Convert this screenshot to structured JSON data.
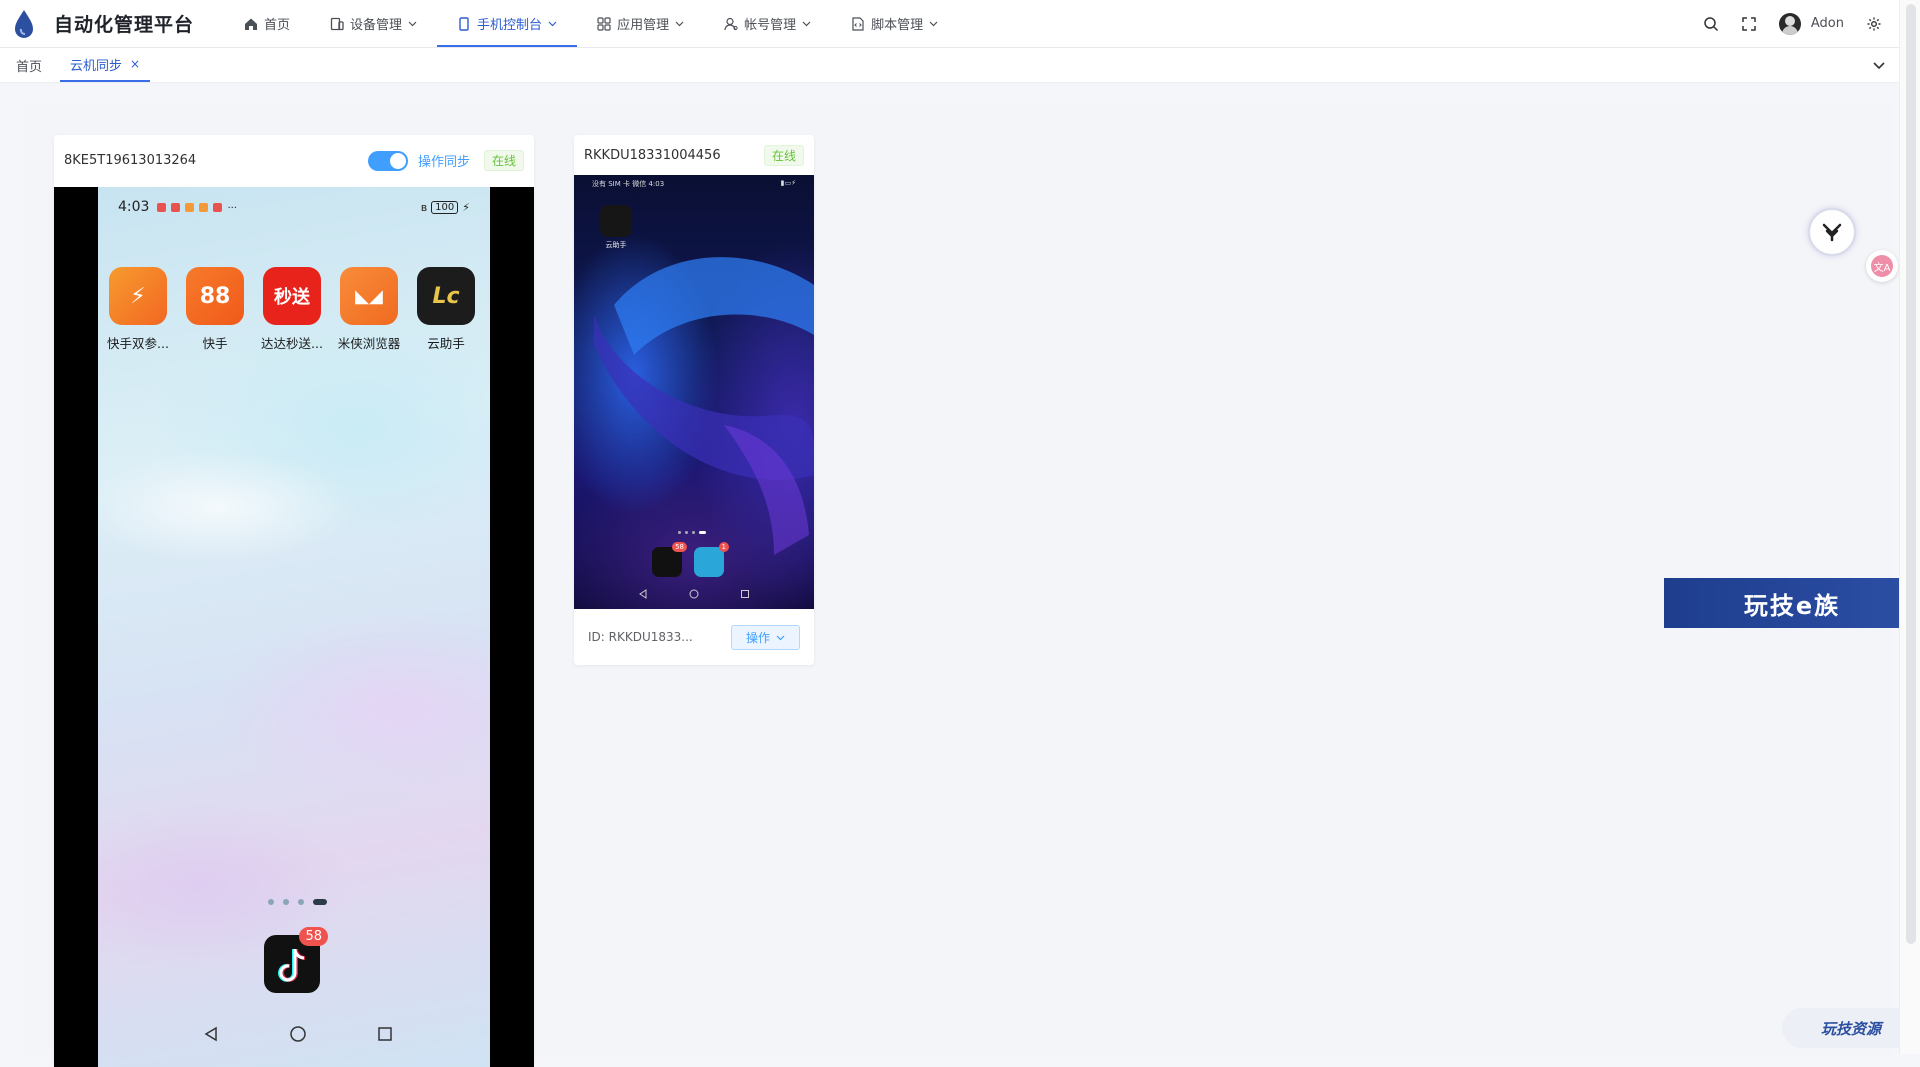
{
  "app": {
    "title": "自动化管理平台"
  },
  "nav": [
    {
      "label": "首页",
      "icon": "home-icon"
    },
    {
      "label": "设备管理",
      "icon": "device-icon"
    },
    {
      "label": "手机控制台",
      "icon": "phone-icon",
      "active": true
    },
    {
      "label": "应用管理",
      "icon": "apps-grid-icon"
    },
    {
      "label": "帐号管理",
      "icon": "user-icon"
    },
    {
      "label": "脚本管理",
      "icon": "code-file-icon"
    }
  ],
  "user": {
    "name": "Adon"
  },
  "tabs": [
    {
      "label": "首页"
    },
    {
      "label": "云机同步",
      "active": true,
      "close": "×"
    }
  ],
  "devices": {
    "d1": {
      "id": "8KE5T19613013264",
      "sync_label": "操作同步",
      "sync_on": true,
      "status": "在线",
      "screen": {
        "time": "4:03",
        "battery": "100",
        "apps": [
          {
            "label": "快手双参...",
            "color": "#f5811f",
            "glyph": "⚡"
          },
          {
            "label": "快手",
            "color": "#f56a1f",
            "glyph": "88"
          },
          {
            "label": "达达秒送...",
            "color": "#e8231c",
            "glyph": "秒送"
          },
          {
            "label": "米侠浏览器",
            "color": "#f4772a",
            "glyph": "◣◢"
          },
          {
            "label": "云助手",
            "color": "#1c1c1c",
            "glyph": "Lc"
          }
        ],
        "dock_badge": "58"
      }
    },
    "d2": {
      "id": "RKKDU18331004456",
      "status": "在线",
      "screen": {
        "status_left": "没有 SIM 卡 微信 4:03",
        "app_label": "云助手",
        "dock_badges": [
          "58",
          "1"
        ]
      },
      "footer_id": "ID: RKKDU1833...",
      "op_label": "操作"
    }
  },
  "widgets": {
    "translate_label": "文A",
    "banner": "玩技e族",
    "watermark": "玩技资源"
  },
  "colors": {
    "accent": "#409eff",
    "online": "#67c23a",
    "nav_active": "#2c5dcf"
  }
}
